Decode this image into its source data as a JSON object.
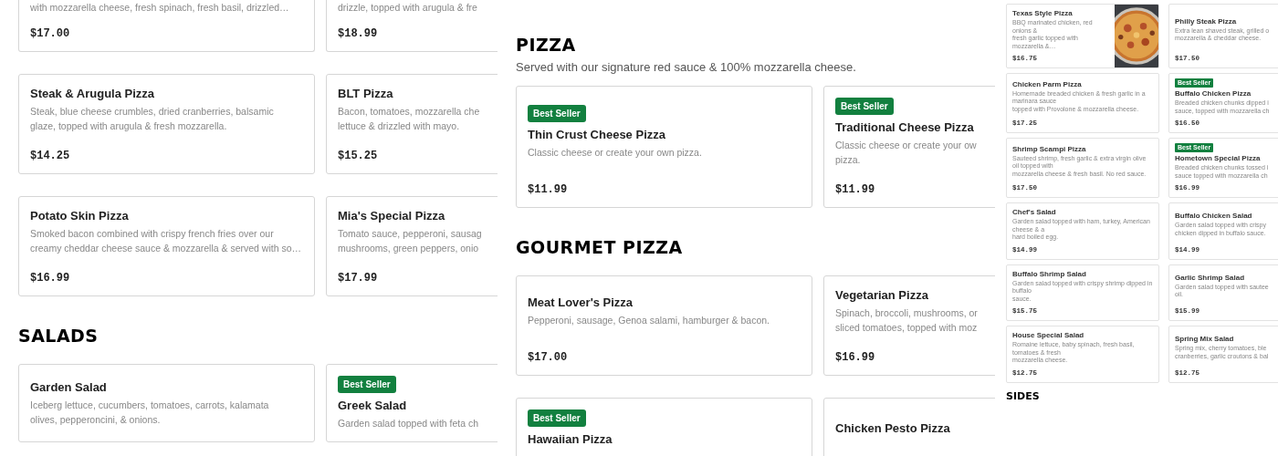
{
  "panels": [
    {
      "kind": "large",
      "blocks": [
        {
          "kind": "cards",
          "cards": [
            {
              "description": [
                "with mozzarella cheese, fresh spinach, fresh basil, drizzled…"
              ],
              "price": "$17.00"
            },
            {
              "description": [
                "drizzle, topped with arugula & fre"
              ],
              "price": "$18.99"
            }
          ]
        },
        {
          "kind": "cards",
          "cards": [
            {
              "name": "Steak & Arugula Pizza",
              "description": [
                "Steak, blue cheese crumbles, dried cranberries, balsamic",
                "glaze, topped with arugula & fresh mozzarella."
              ],
              "price": "$14.25"
            },
            {
              "name": "BLT Pizza",
              "description": [
                "Bacon, tomatoes, mozzarella che",
                "lettuce & drizzled with mayo."
              ],
              "price": "$15.25"
            }
          ]
        },
        {
          "kind": "cards",
          "cards": [
            {
              "name": "Potato Skin Pizza",
              "description": [
                "Smoked bacon combined with crispy french fries over our",
                "creamy cheddar cheese sauce & mozzarella & served with so…"
              ],
              "price": "$16.99"
            },
            {
              "name": "Mia's Special Pizza",
              "description": [
                "Tomato sauce, pepperoni, sausag",
                "mushrooms, green peppers, onio"
              ],
              "price": "$17.99"
            }
          ]
        },
        {
          "kind": "heading",
          "text": "SALADS"
        },
        {
          "kind": "cards",
          "cards": [
            {
              "name": "Garden Salad",
              "description": [
                "Iceberg lettuce, cucumbers, tomatoes, carrots, kalamata",
                "olives, pepperoncini, & onions."
              ]
            },
            {
              "name": "Greek Salad",
              "badge": "Best Seller",
              "description": [
                "Garden salad topped with feta ch"
              ]
            }
          ]
        }
      ]
    },
    {
      "kind": "large",
      "blocks": [
        {
          "kind": "heading",
          "text": "PIZZA"
        },
        {
          "kind": "subtitle",
          "text": "Served with our signature red sauce & 100% mozzarella cheese."
        },
        {
          "kind": "cards",
          "cards": [
            {
              "name": "Thin Crust Cheese Pizza",
              "badge": "Best Seller",
              "description": [
                "Classic cheese or create your own pizza."
              ],
              "price": "$11.99"
            },
            {
              "name": "Traditional Cheese Pizza",
              "badge": "Best Seller",
              "description": [
                "Classic cheese or create your ow",
                "pizza."
              ],
              "price": "$11.99"
            }
          ]
        },
        {
          "kind": "heading",
          "text": "GOURMET PIZZA"
        },
        {
          "kind": "cards",
          "cards": [
            {
              "name": "Meat Lover's Pizza",
              "description": [
                "Pepperoni, sausage, Genoa salami, hamburger & bacon."
              ],
              "price": "$17.00"
            },
            {
              "name": "Vegetarian Pizza",
              "description": [
                "Spinach, broccoli, mushrooms, or",
                "sliced tomatoes, topped with moz"
              ],
              "price": "$16.99"
            }
          ]
        },
        {
          "kind": "cards",
          "cards": [
            {
              "name": "Hawaiian Pizza",
              "badge": "Best Seller"
            },
            {
              "name": "Chicken Pesto Pizza"
            }
          ]
        }
      ]
    },
    {
      "kind": "small",
      "blocks": [
        {
          "kind": "cards",
          "cards": [
            {
              "name": "Texas Style Pizza",
              "picture": true,
              "description": [
                "BBQ marinated chicken, red onions &",
                "fresh garlic topped with mozzarella &…"
              ],
              "price": "$16.75"
            },
            {
              "name": "Philly Steak Pizza",
              "description": [
                "Extra lean shaved steak, grilled o",
                "mozzarella & cheddar cheese."
              ],
              "price": "$17.50"
            }
          ]
        },
        {
          "kind": "cards",
          "cards": [
            {
              "name": "Chicken Parm Pizza",
              "description": [
                "Homemade breaded chicken & fresh garlic in a marinara sauce",
                "topped with Provolone & mozzarella cheese."
              ],
              "price": "$17.25"
            },
            {
              "name": "Buffalo Chicken Pizza",
              "badge": "Best Seller",
              "description": [
                "Breaded chicken chunks dipped i",
                "sauce, topped with mozzarella ch"
              ],
              "price": "$16.50"
            }
          ]
        },
        {
          "kind": "cards",
          "cards": [
            {
              "name": "Shrimp Scampi Pizza",
              "description": [
                "Sauteed shrimp, fresh garlic & extra virgin olive oil topped with",
                "mozzarella cheese & fresh basil. No red sauce."
              ],
              "price": "$17.50"
            },
            {
              "name": "Hometown Special Pizza",
              "badge": "Best Seller",
              "description": [
                "Breaded chicken chunks tossed i",
                "sauce topped with mozzarella ch"
              ],
              "price": "$16.99"
            }
          ]
        },
        {
          "kind": "cards",
          "cards": [
            {
              "name": "Chef's Salad",
              "description": [
                "Garden salad topped with ham, turkey, American cheese & a",
                "hard boiled egg."
              ],
              "price": "$14.99"
            },
            {
              "name": "Buffalo Chicken Salad",
              "description": [
                "Garden salad topped with crispy",
                "chicken dipped in buffalo sauce."
              ],
              "price": "$14.99"
            }
          ]
        },
        {
          "kind": "cards",
          "cards": [
            {
              "name": "Buffalo Shrimp Salad",
              "description": [
                "Garden salad topped with crispy shrimp dipped in buffalo",
                "sauce."
              ],
              "price": "$15.75"
            },
            {
              "name": "Garlic Shrimp Salad",
              "description": [
                "Garden salad topped with sautee",
                "oil."
              ],
              "price": "$15.99"
            }
          ]
        },
        {
          "kind": "cards",
          "cards": [
            {
              "name": "House Special Salad",
              "description": [
                "Romaine lettuce, baby spinach, fresh basil, tomatoes & fresh",
                "mozzarella cheese."
              ],
              "price": "$12.75"
            },
            {
              "name": "Spring Mix Salad",
              "description": [
                "Spring mix, cherry tomatoes, ble",
                "cranberries, garlic croutons & bal"
              ],
              "price": "$12.75"
            }
          ]
        },
        {
          "kind": "heading",
          "text": "SIDES"
        }
      ]
    }
  ]
}
